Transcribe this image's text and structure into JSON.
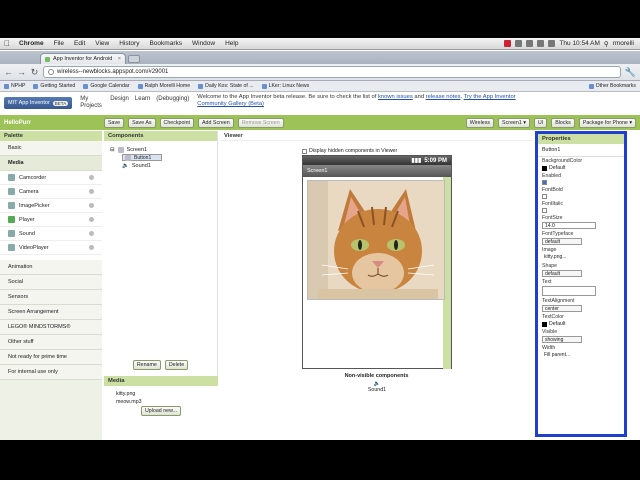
{
  "menubar": {
    "app": "Chrome",
    "items": [
      "File",
      "Edit",
      "View",
      "History",
      "Bookmarks",
      "Window",
      "Help"
    ],
    "clock": "Thu 10:54 AM",
    "user": "rmorelli"
  },
  "browser": {
    "tab_title": "App Inventor for Android",
    "url": "wireless--newblocks.appspot.com/#29001",
    "bookmarks": [
      "NPHP",
      "Getting Started",
      "Google Calendar",
      "Ralph Morelli Home",
      "Daily Kos: State of ...",
      "LKer: Linux News"
    ],
    "other_bookmarks": "Other Bookmarks"
  },
  "app": {
    "logo": "MIT App Inventor",
    "beta": "BETA",
    "nav": [
      "My Projects",
      "Design",
      "Learn",
      "(Debugging)"
    ],
    "welcome_prefix": "Welcome to the App Inventor beta release. Be sure to check the list of ",
    "welcome_link1": "known issues",
    "welcome_and": " and ",
    "welcome_link2": "release notes",
    "welcome_dot": ". ",
    "welcome_link3": "Try the App Inventor Community Gallery (Beta)"
  },
  "project": {
    "name": "HelloPurr",
    "buttons": [
      "Save",
      "Save As",
      "Checkpoint",
      "Add Screen"
    ],
    "remove_screen": "Remove Screen",
    "right_buttons": [
      "Wireless",
      "Screen1 ▾",
      "UI",
      "Blocks",
      "Package for Phone ▾"
    ]
  },
  "palette": {
    "title": "Palette",
    "basic": "Basic",
    "media": "Media",
    "media_items": [
      "Camcorder",
      "Camera",
      "ImagePicker",
      "Player",
      "Sound",
      "VideoPlayer"
    ],
    "categories": [
      "Animation",
      "Social",
      "Sensors",
      "Screen Arrangement",
      "LEGO® MINDSTORMS®",
      "Other stuff",
      "Not ready for prime time",
      "For internal use only"
    ]
  },
  "components": {
    "title": "Components",
    "tree": [
      "Screen1",
      "Button1",
      "Sound1"
    ],
    "rename": "Rename",
    "delete": "Delete"
  },
  "media": {
    "title": "Media",
    "files": [
      "kitty.png",
      "meow.mp3"
    ],
    "upload": "Upload new..."
  },
  "viewer": {
    "title": "Viewer",
    "hidden_label": "Display hidden components in Viewer",
    "phone_time": "5:09 PM",
    "screen_title": "Screen1",
    "nonvisible_title": "Non-visible components",
    "nonvisible_item": "Sound1"
  },
  "properties": {
    "title": "Properties",
    "component": "Button1",
    "background_color_label": "BackgroundColor",
    "background_color": "Default",
    "enabled_label": "Enabled",
    "fontbold_label": "FontBold",
    "fontitalic_label": "FontItalic",
    "fontsize_label": "FontSize",
    "fontsize": "14.0",
    "typeface_label": "FontTypeface",
    "typeface": "default",
    "image_label": "Image",
    "image": "kitty.png...",
    "shape_label": "Shape",
    "shape": "default",
    "text_label": "Text",
    "text": "",
    "align_label": "TextAlignment",
    "align": "center",
    "textcolor_label": "TextColor",
    "textcolor": "Default",
    "visible_label": "Visible",
    "visible": "showing",
    "width_label": "Width",
    "width": "Fill parent..."
  }
}
